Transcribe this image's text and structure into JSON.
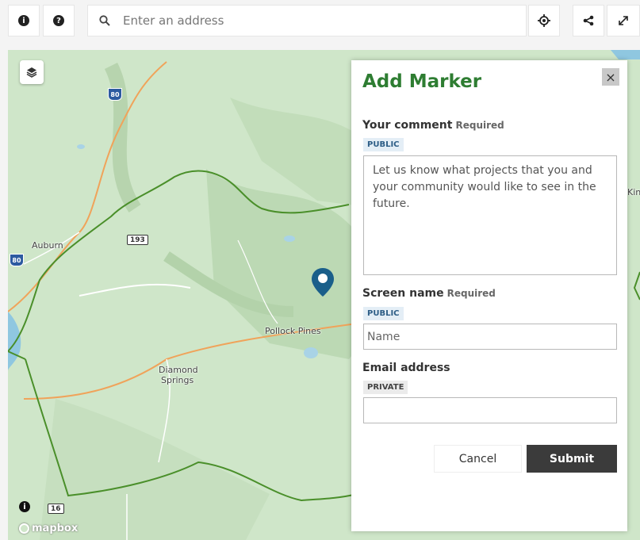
{
  "search": {
    "placeholder": "Enter an address"
  },
  "toolbar": {
    "info_icon": "info-circle",
    "help_icon": "question-circle",
    "locate_icon": "crosshair",
    "share_icon": "share",
    "fullscreen_icon": "expand"
  },
  "map": {
    "labels": {
      "auburn": "Auburn",
      "pollock_pines": "Pollock Pines",
      "diamond": "Diamond",
      "springs": "Springs",
      "kin": "Kin"
    },
    "shields": {
      "i80_top": "80",
      "i80_left": "80",
      "hwy193": "193",
      "hwy16": "16"
    },
    "attribution": "mapbox",
    "info_icon": "i"
  },
  "marker_form": {
    "title": "Add Marker",
    "close_label": "×",
    "comment": {
      "label": "Your comment",
      "required": "Required",
      "visibility": "PUBLIC",
      "placeholder": "Let us know what projects that you and your community would like to see in the future."
    },
    "screen_name": {
      "label": "Screen name",
      "required": "Required",
      "visibility": "PUBLIC",
      "placeholder": "Name"
    },
    "email": {
      "label": "Email address",
      "visibility": "PRIVATE",
      "value": ""
    },
    "cancel_label": "Cancel",
    "submit_label": "Submit"
  },
  "colors": {
    "title_green": "#2e7d32",
    "marker_blue": "#1a5f8a",
    "submit_bg": "#3b3b3b",
    "boundary_green": "#4a8f2a",
    "road_orange": "#f0a35a"
  }
}
